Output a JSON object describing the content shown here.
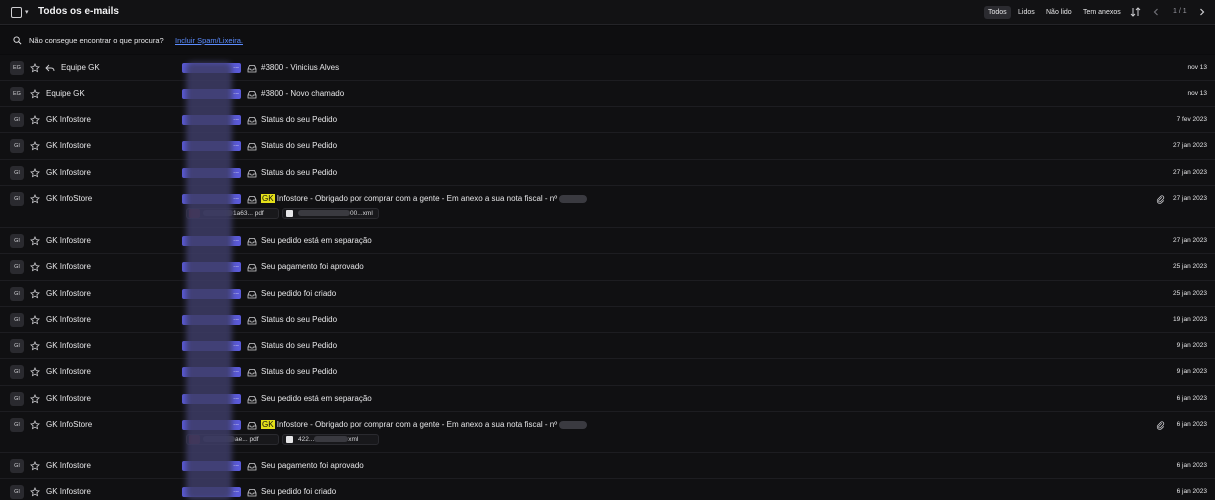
{
  "toolbar": {
    "title": "Todos os e-mails",
    "filters": {
      "all": "Todos",
      "read": "Lidos",
      "unread": "Não lido",
      "attachments": "Tem anexos"
    },
    "active_filter": "Todos",
    "page_count": "1 / 1"
  },
  "hint": {
    "text": "Não consegue encontrar o que procura?",
    "link": "Incluir Spam/Lixeira."
  },
  "rows": [
    {
      "initials": "EG",
      "sender": "Equipe GK",
      "replied": true,
      "subject": "#3800 - Vinicius Alves",
      "date": "nov 13"
    },
    {
      "initials": "EG",
      "sender": "Equipe GK",
      "subject": "#3800 - Novo chamado",
      "date": "nov 13"
    },
    {
      "initials": "GI",
      "sender": "GK Infostore",
      "subject": "Status do seu Pedido",
      "date": "7 fev 2023"
    },
    {
      "initials": "GI",
      "sender": "GK Infostore",
      "subject": "Status do seu Pedido",
      "date": "27 jan 2023"
    },
    {
      "initials": "GI",
      "sender": "GK Infostore",
      "subject": "Status do seu Pedido",
      "date": "27 jan 2023"
    },
    {
      "initials": "GI",
      "sender": "GK InfoStore",
      "subject_highlight": "GK",
      "subject_rest": " Infostore - Obrigado por comprar com a gente - Em anexo a sua nota fiscal - nº",
      "date": "27 jan 2023",
      "attachments": [
        {
          "name_visible": "1a63...",
          "ext": "pdf"
        },
        {
          "name_visible": "00...",
          "ext": "xml"
        }
      ]
    },
    {
      "initials": "GI",
      "sender": "GK Infostore",
      "subject": "Seu pedido está em separação",
      "date": "27 jan 2023"
    },
    {
      "initials": "GI",
      "sender": "GK Infostore",
      "subject": "Seu pagamento foi aprovado",
      "date": "25 jan 2023"
    },
    {
      "initials": "GI",
      "sender": "GK Infostore",
      "subject": "Seu pedido foi criado",
      "date": "25 jan 2023"
    },
    {
      "initials": "GI",
      "sender": "GK Infostore",
      "subject": "Status do seu Pedido",
      "date": "19 jan 2023"
    },
    {
      "initials": "GI",
      "sender": "GK Infostore",
      "subject": "Status do seu Pedido",
      "date": "9 jan 2023"
    },
    {
      "initials": "GI",
      "sender": "GK Infostore",
      "subject": "Status do seu Pedido",
      "date": "9 jan 2023"
    },
    {
      "initials": "GI",
      "sender": "GK Infostore",
      "subject": "Seu pedido está em separação",
      "date": "6 jan 2023"
    },
    {
      "initials": "GI",
      "sender": "GK InfoStore",
      "subject_highlight": "GK",
      "subject_rest": " Infostore - Obrigado por comprar com a gente - Em anexo a sua nota fiscal - nº",
      "date": "6 jan 2023",
      "attachments": [
        {
          "name_visible": "ae...",
          "ext": "pdf"
        },
        {
          "name_visible": "422...",
          "ext": "xml"
        }
      ]
    },
    {
      "initials": "GI",
      "sender": "GK Infostore",
      "subject": "Seu pagamento foi aprovado",
      "date": "6 jan 2023"
    },
    {
      "initials": "GI",
      "sender": "GK Infostore",
      "subject": "Seu pedido foi criado",
      "date": "6 jan 2023"
    }
  ],
  "colors": {
    "label_chip": "#5a5ad8",
    "highlight": "#e4e01a",
    "link": "#5b8cff",
    "background": "#0b0b0d"
  },
  "icons": {
    "star": "star-icon",
    "reply": "reply-icon",
    "inbox": "inbox-icon",
    "attachment": "paperclip-icon",
    "search": "search-icon",
    "sort": "sort-icon"
  }
}
